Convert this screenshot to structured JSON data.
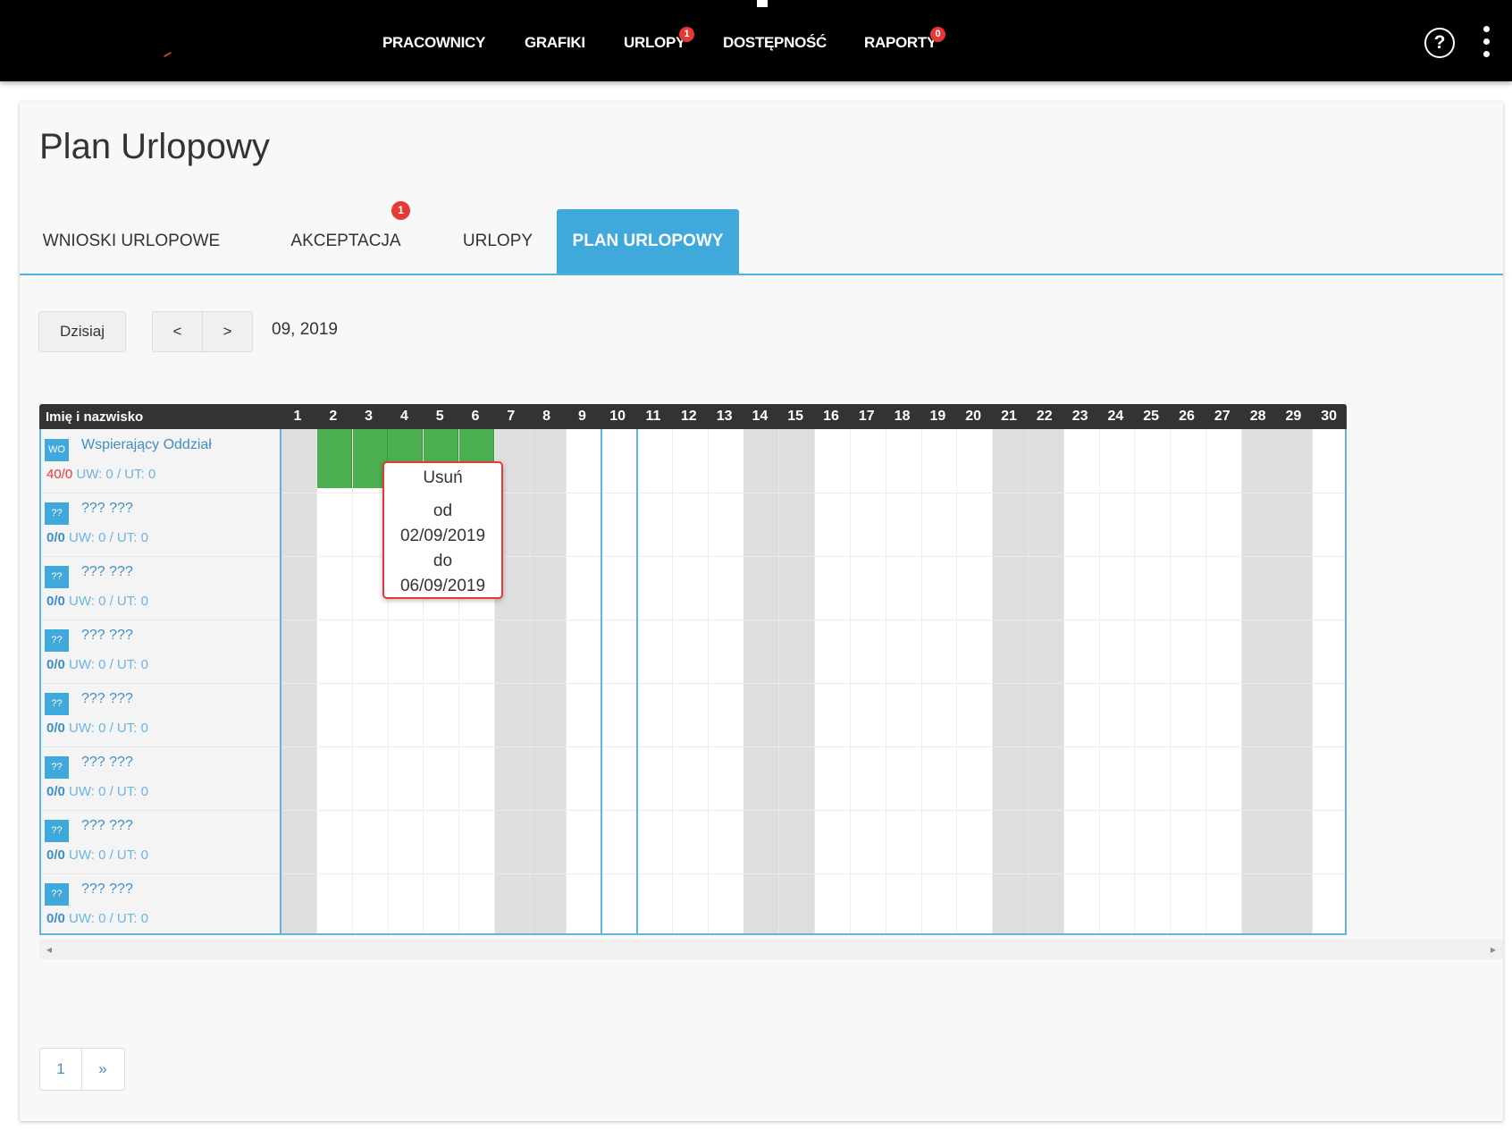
{
  "nav": {
    "items": [
      {
        "label": "PRACOWNICY"
      },
      {
        "label": "GRAFIKI"
      },
      {
        "label": "URLOPY",
        "badge": "1"
      },
      {
        "label": "DOSTĘPNOŚĆ"
      },
      {
        "label": "RAPORTY",
        "badge": "0"
      }
    ],
    "help_icon": "question-circle-icon",
    "help_glyph": "?",
    "more_icon": "vertical-dots-icon"
  },
  "page": {
    "title": "Plan Urlopowy"
  },
  "tabs": [
    {
      "label": "WNIOSKI URLOPOWE"
    },
    {
      "label": "AKCEPTACJA",
      "badge": "1"
    },
    {
      "label": "URLOPY"
    },
    {
      "label": "PLAN URLOPOWY",
      "active": true
    }
  ],
  "toolbar": {
    "today_label": "Dzisiaj",
    "prev_label": "<",
    "next_label": ">",
    "month": "09, 2019"
  },
  "grid": {
    "name_header": "Imię i nazwisko",
    "days": [
      "1",
      "2",
      "3",
      "4",
      "5",
      "6",
      "7",
      "8",
      "9",
      "10",
      "11",
      "12",
      "13",
      "14",
      "15",
      "16",
      "17",
      "18",
      "19",
      "20",
      "21",
      "22",
      "23",
      "24",
      "25",
      "26",
      "27",
      "28",
      "29",
      "30"
    ],
    "weekend_days": [
      1,
      7,
      8,
      14,
      15,
      21,
      22,
      28,
      29
    ],
    "today_day": 10,
    "employees": [
      {
        "initials": "WO",
        "name": "Wspierający Oddział",
        "balance": "40/0",
        "balance_warn": true,
        "stats": "UW: 0 / UT: 0"
      },
      {
        "initials": "??",
        "name": "??? ???",
        "balance": "0/0",
        "balance_warn": false,
        "stats": "UW: 0 / UT: 0"
      },
      {
        "initials": "??",
        "name": "??? ???",
        "balance": "0/0",
        "balance_warn": false,
        "stats": "UW: 0 / UT: 0"
      },
      {
        "initials": "??",
        "name": "??? ???",
        "balance": "0/0",
        "balance_warn": false,
        "stats": "UW: 0 / UT: 0"
      },
      {
        "initials": "??",
        "name": "??? ???",
        "balance": "0/0",
        "balance_warn": false,
        "stats": "UW: 0 / UT: 0"
      },
      {
        "initials": "??",
        "name": "??? ???",
        "balance": "0/0",
        "balance_warn": false,
        "stats": "UW: 0 / UT: 0"
      },
      {
        "initials": "??",
        "name": "??? ???",
        "balance": "0/0",
        "balance_warn": false,
        "stats": "UW: 0 / UT: 0"
      },
      {
        "initials": "??",
        "name": "??? ???",
        "balance": "0/0",
        "balance_warn": false,
        "stats": "UW: 0 / UT: 0"
      }
    ],
    "leave": {
      "employee_index": 0,
      "from_day": 2,
      "to_day": 6,
      "color": "#4caf50"
    }
  },
  "popup": {
    "delete_label": "Usuń",
    "from_label": "od",
    "from_date": "02/09/2019",
    "to_label": "do",
    "to_date": "06/09/2019"
  },
  "pagination": {
    "current": "1",
    "next_label": "»"
  },
  "scrollbar": {
    "left_arrow": "◂",
    "right_arrow": "▸"
  },
  "colors": {
    "accent": "#3fa9dc",
    "badge": "#e53935",
    "leave": "#4caf50",
    "weekend": "#dedede",
    "topbar": "#000000"
  }
}
